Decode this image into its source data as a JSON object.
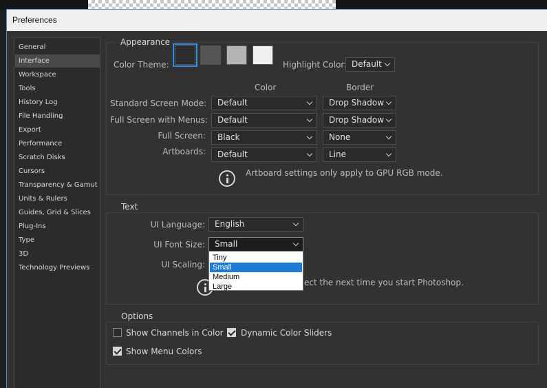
{
  "window": {
    "title": "Preferences"
  },
  "sidebar": {
    "items": [
      {
        "label": "General"
      },
      {
        "label": "Interface"
      },
      {
        "label": "Workspace"
      },
      {
        "label": "Tools"
      },
      {
        "label": "History Log"
      },
      {
        "label": "File Handling"
      },
      {
        "label": "Export"
      },
      {
        "label": "Performance"
      },
      {
        "label": "Scratch Disks"
      },
      {
        "label": "Cursors"
      },
      {
        "label": "Transparency & Gamut"
      },
      {
        "label": "Units & Rulers"
      },
      {
        "label": "Guides, Grid & Slices"
      },
      {
        "label": "Plug-Ins"
      },
      {
        "label": "Type"
      },
      {
        "label": "3D"
      },
      {
        "label": "Technology Previews"
      }
    ],
    "selected": "Interface"
  },
  "appearance": {
    "title": "Appearance",
    "color_theme_label": "Color Theme:",
    "themes": [
      "#2d2d2d",
      "#555555",
      "#b4b4b4",
      "#f0f0f0"
    ],
    "selected_theme": 0,
    "highlight_label": "Highlight Color:",
    "highlight_value": "Default",
    "col_color": "Color",
    "col_border": "Border",
    "rows": [
      {
        "label": "Standard Screen Mode:",
        "color": "Default",
        "border": "Drop Shadow"
      },
      {
        "label": "Full Screen with Menus:",
        "color": "Default",
        "border": "Drop Shadow"
      },
      {
        "label": "Full Screen:",
        "color": "Black",
        "border": "None"
      },
      {
        "label": "Artboards:",
        "color": "Default",
        "border": "Line"
      }
    ],
    "info_note": "Artboard settings only apply to GPU RGB mode."
  },
  "text": {
    "title": "Text",
    "ui_language_label": "UI Language:",
    "ui_language_value": "English",
    "ui_font_size_label": "UI Font Size:",
    "ui_font_size_value": "Small",
    "ui_scaling_label": "UI Scaling:",
    "info_note_visible": "ect the next time you start Photoshop.",
    "font_size_options": [
      "Tiny",
      "Small",
      "Medium",
      "Large"
    ],
    "highlighted_option": "Small"
  },
  "options": {
    "title": "Options",
    "show_channels_label": "Show Channels in Color",
    "show_channels_checked": false,
    "dynamic_sliders_label": "Dynamic Color Sliders",
    "dynamic_sliders_checked": true,
    "show_menu_colors_label": "Show Menu Colors",
    "show_menu_colors_checked": true
  },
  "colors": {
    "panel": "#323232",
    "accent": "#2d8ceb",
    "list_highlight": "#1e7ad6"
  }
}
